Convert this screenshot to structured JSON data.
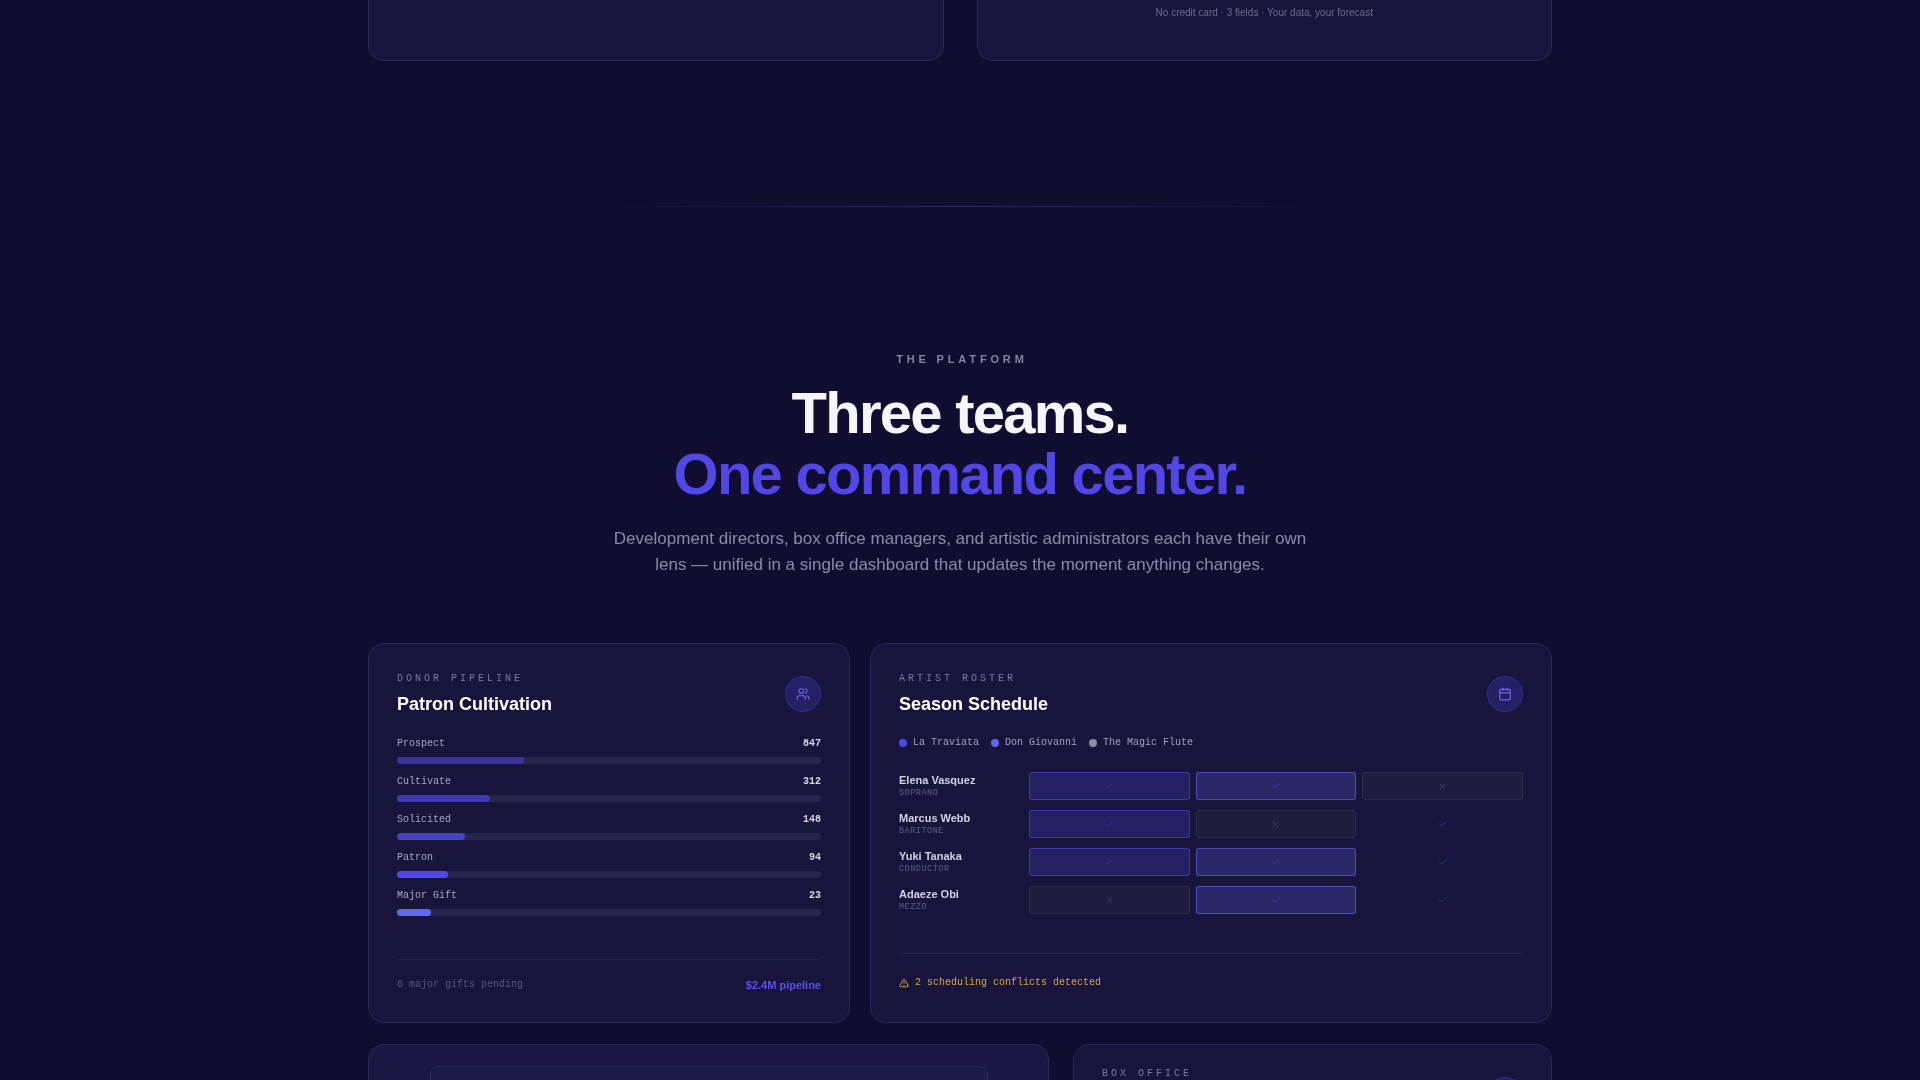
{
  "top_card": {
    "note": "No credit card · 3 fields · Your data, your forecast"
  },
  "section": {
    "eyebrow": "THE PLATFORM",
    "headline": "Three teams.",
    "headline_accent": "One command center.",
    "description": "Development directors, box office managers, and artistic administrators each have their own lens — unified in a single dashboard that updates the moment anything changes."
  },
  "pipeline": {
    "eyebrow": "DONOR PIPELINE",
    "title": "Patron Cultivation",
    "stages": [
      {
        "label": "Prospect",
        "count": "847",
        "level": 0.3,
        "color": "#3b3598"
      },
      {
        "label": "Cultivate",
        "count": "312",
        "level": 0.22,
        "color": "#4139ae"
      },
      {
        "label": "Solicited",
        "count": "148",
        "level": 0.16,
        "color": "#4a40c6"
      },
      {
        "label": "Patron",
        "count": "94",
        "level": 0.12,
        "color": "#5248df"
      },
      {
        "label": "Major Gift",
        "count": "23",
        "level": 0.08,
        "color": "#6366f1"
      }
    ],
    "footer_note": "6 major gifts pending",
    "footer_value": "$2.4M pipeline"
  },
  "schedule": {
    "eyebrow": "ARTIST ROSTER",
    "title": "Season Schedule",
    "legend": [
      {
        "label": "La Traviata",
        "color": "#4f46e5"
      },
      {
        "label": "Don Giovanni",
        "color": "#6366f1"
      },
      {
        "label": "The Magic Flute",
        "color": "#8e8aa8"
      }
    ],
    "rows": [
      {
        "name": "Elena Vasquez",
        "role": "SOPRANO",
        "cells": [
          {
            "kind": "booked"
          },
          {
            "kind": "booked"
          },
          {
            "kind": "unavailable"
          }
        ]
      },
      {
        "name": "Marcus Webb",
        "role": "BARITONE",
        "cells": [
          {
            "kind": "booked"
          },
          {
            "kind": "unavailable"
          },
          {
            "kind": "open"
          }
        ]
      },
      {
        "name": "Yuki Tanaka",
        "role": "CONDUCTOR",
        "cells": [
          {
            "kind": "booked"
          },
          {
            "kind": "booked"
          },
          {
            "kind": "open"
          }
        ]
      },
      {
        "name": "Adaeze Obi",
        "role": "MEZZO",
        "cells": [
          {
            "kind": "unavailable"
          },
          {
            "kind": "booked"
          },
          {
            "kind": "open"
          }
        ]
      }
    ],
    "alert": "2 scheduling conflicts detected"
  },
  "box_office": {
    "eyebrow": "BOX OFFICE"
  }
}
